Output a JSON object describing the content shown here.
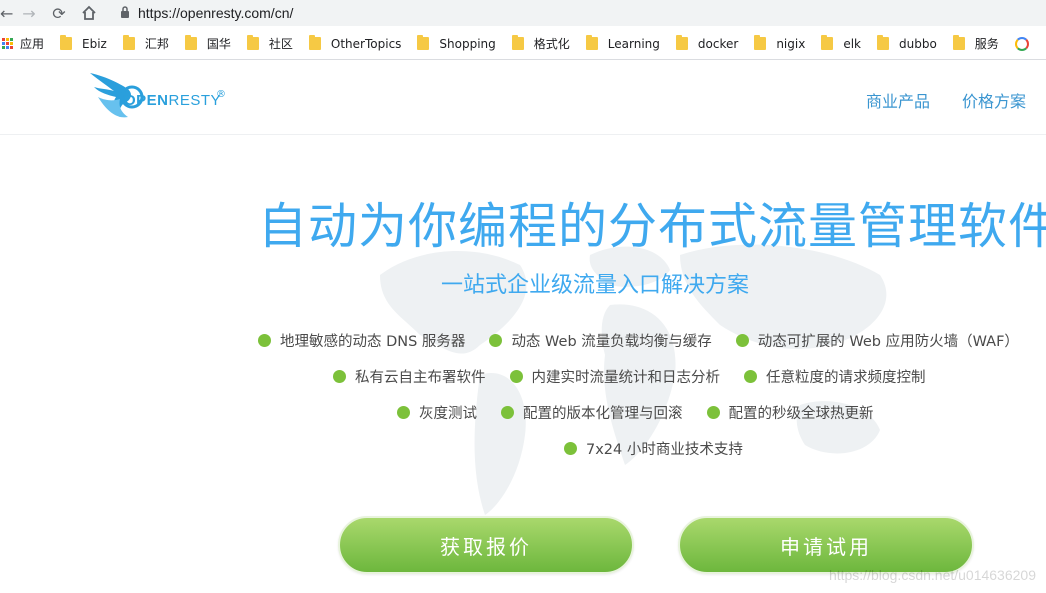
{
  "browser": {
    "url": "https://openresty.com/cn/",
    "bookmarks": [
      {
        "label": "应用",
        "type": "apps"
      },
      {
        "label": "Ebiz",
        "type": "folder"
      },
      {
        "label": "汇邦",
        "type": "folder"
      },
      {
        "label": "国华",
        "type": "folder"
      },
      {
        "label": "社区",
        "type": "folder"
      },
      {
        "label": "OtherTopics",
        "type": "folder"
      },
      {
        "label": "Shopping",
        "type": "folder"
      },
      {
        "label": "格式化",
        "type": "folder"
      },
      {
        "label": "Learning",
        "type": "folder"
      },
      {
        "label": "docker",
        "type": "folder"
      },
      {
        "label": "nigix",
        "type": "folder"
      },
      {
        "label": "elk",
        "type": "folder"
      },
      {
        "label": "dubbo",
        "type": "folder"
      },
      {
        "label": "服务",
        "type": "folder"
      }
    ]
  },
  "header": {
    "logo_open": "OPEN",
    "logo_resty": "RESTY",
    "logo_reg": "®",
    "nav": [
      "商业产品",
      "价格方案"
    ]
  },
  "hero": {
    "title": "自动为你编程的分布式流量管理软件",
    "subtitle": "一站式企业级流量入口解决方案",
    "features": [
      [
        "地理敏感的动态 DNS 服务器",
        "动态 Web 流量负载均衡与缓存",
        "动态可扩展的 Web 应用防火墙（WAF）"
      ],
      [
        "私有云自主布署软件",
        "内建实时流量统计和日志分析",
        "任意粒度的请求频度控制"
      ],
      [
        "灰度测试",
        "配置的版本化管理与回滚",
        "配置的秒级全球热更新"
      ],
      [
        "7x24 小时商业技术支持"
      ]
    ],
    "buttons": {
      "quote": "获取报价",
      "trial": "申请试用"
    },
    "watermark": "https://blog.csdn.net/u014636209"
  },
  "colors": {
    "accent_blue": "#3fa9ef",
    "nav_blue": "#3a95d0",
    "feature_dot": "#7cc13a",
    "button_green": "#8cc84b"
  }
}
